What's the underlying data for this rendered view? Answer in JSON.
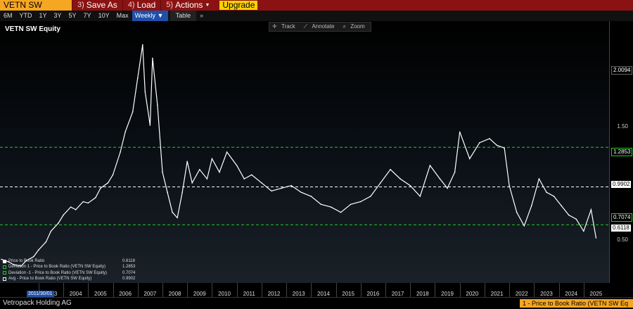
{
  "toolbar": {
    "ticker": "VETN SW Equity",
    "save_num": "3)",
    "save_label": "Save As",
    "load_num": "4)",
    "load_label": "Load",
    "actions_num": "5)",
    "actions_label": "Actions",
    "upgrade_label": "Upgrade"
  },
  "ranges": {
    "items": [
      "6M",
      "YTD",
      "1Y",
      "3Y",
      "5Y",
      "7Y",
      "10Y",
      "Max"
    ],
    "frequency": "Weekly ▼",
    "table_label": "Table",
    "more": "»"
  },
  "chart_tools": [
    "Track",
    "Annotate",
    "Zoom"
  ],
  "chart_data": {
    "type": "line",
    "title": "VETN SW Equity",
    "x_ticks": [
      "2003",
      "2004",
      "2005",
      "2006",
      "2007",
      "2008",
      "2009",
      "2010",
      "2011",
      "2012",
      "2013",
      "2014",
      "2015",
      "2016",
      "2017",
      "2018",
      "2019",
      "2020",
      "2021",
      "2022",
      "2023",
      "2024",
      "2025"
    ],
    "y_ticks": [
      0.5,
      1.5,
      2.0094
    ],
    "ylim": [
      0.3,
      2.2
    ],
    "xlim": [
      2001.5,
      2025.8
    ],
    "series": [
      {
        "name": "Price to Book Ratio",
        "color": "#ffffff",
        "x": [
          2001.5,
          2001.8,
          2002.0,
          2002.3,
          2002.5,
          2002.8,
          2003.0,
          2003.3,
          2003.5,
          2003.8,
          2004.0,
          2004.3,
          2004.5,
          2004.8,
          2005.0,
          2005.3,
          2005.5,
          2005.8,
          2006.0,
          2006.3,
          2006.5,
          2006.8,
          2007.0,
          2007.2,
          2007.3,
          2007.5,
          2007.6,
          2007.8,
          2008.0,
          2008.2,
          2008.4,
          2008.6,
          2008.8,
          2009.0,
          2009.2,
          2009.5,
          2009.8,
          2010.0,
          2010.3,
          2010.6,
          2011.0,
          2011.3,
          2011.6,
          2012.0,
          2012.4,
          2012.8,
          2013.2,
          2013.6,
          2014.0,
          2014.4,
          2014.8,
          2015.2,
          2015.6,
          2016.0,
          2016.4,
          2016.8,
          2017.2,
          2017.6,
          2018.0,
          2018.4,
          2018.8,
          2019.2,
          2019.5,
          2019.8,
          2020.0,
          2020.4,
          2020.8,
          2021.2,
          2021.5,
          2021.8,
          2022.0,
          2022.3,
          2022.6,
          2022.9,
          2023.2,
          2023.5,
          2023.8,
          2024.1,
          2024.4,
          2024.7,
          2025.0,
          2025.3,
          2025.5
        ],
        "values": [
          0.45,
          0.43,
          0.41,
          0.4,
          0.44,
          0.47,
          0.52,
          0.58,
          0.66,
          0.72,
          0.78,
          0.84,
          0.82,
          0.88,
          0.87,
          0.91,
          0.98,
          1.02,
          1.08,
          1.25,
          1.4,
          1.55,
          1.8,
          2.05,
          1.7,
          1.45,
          1.95,
          1.6,
          1.1,
          0.95,
          0.8,
          0.76,
          0.95,
          1.18,
          1.02,
          1.12,
          1.05,
          1.2,
          1.1,
          1.25,
          1.15,
          1.05,
          1.08,
          1.02,
          0.96,
          0.98,
          1.0,
          0.95,
          0.92,
          0.86,
          0.84,
          0.8,
          0.86,
          0.88,
          0.92,
          1.02,
          1.12,
          1.05,
          1.0,
          0.92,
          1.15,
          1.05,
          0.98,
          1.1,
          1.4,
          1.2,
          1.32,
          1.35,
          1.3,
          1.28,
          1.0,
          0.8,
          0.7,
          0.85,
          1.05,
          0.95,
          0.92,
          0.85,
          0.78,
          0.75,
          0.66,
          0.82,
          0.61
        ]
      }
    ],
    "reference_lines": [
      {
        "name": "Deviation 1 - Price to Book Ratio (VETN SW Equity)",
        "value": 1.2853,
        "color": "#22cc22"
      },
      {
        "name": "Avg - Price to Book Ratio (VETN SW Equity)",
        "value": 0.9902,
        "color": "#ffffff"
      },
      {
        "name": "Deviation -1 - Price to Book Ratio (VETN SW Equity)",
        "value": 0.7074,
        "color": "#22cc22"
      }
    ],
    "last_value": 0.6118
  },
  "axis_tags": {
    "top": "2.0094",
    "dev1": "1.2853",
    "avg": "0.9902",
    "devm1": "0.7074",
    "last": "0.6118"
  },
  "y_labels": {
    "l150": "1.50",
    "l050": "0.50"
  },
  "legend": {
    "rows": [
      {
        "label": "Price to Book Ratio",
        "value": "0.6118",
        "color": "#ffffff"
      },
      {
        "label": "Deviation 1 - Price to Book Ratio (VETN SW Equity)",
        "value": "1.2853",
        "color": "#22cc22"
      },
      {
        "label": "Deviation -1 - Price to Book Ratio (VETN SW Equity)",
        "value": "0.7074",
        "color": "#22cc22"
      },
      {
        "label": "Avg - Price to Book Ratio (VETN SW Equity)",
        "value": "0.9902",
        "color": "#ffffff"
      }
    ]
  },
  "date_badge": "2011/30/01",
  "footer": {
    "company": "Vetropack Holding AG",
    "status": "1 - Price to Book Ratio (VETN SW Eq"
  },
  "colors": {
    "accent": "#f5a623",
    "bar_red": "#8a1212",
    "selected_blue": "#1f4fa8",
    "dev_green": "#22cc22"
  }
}
